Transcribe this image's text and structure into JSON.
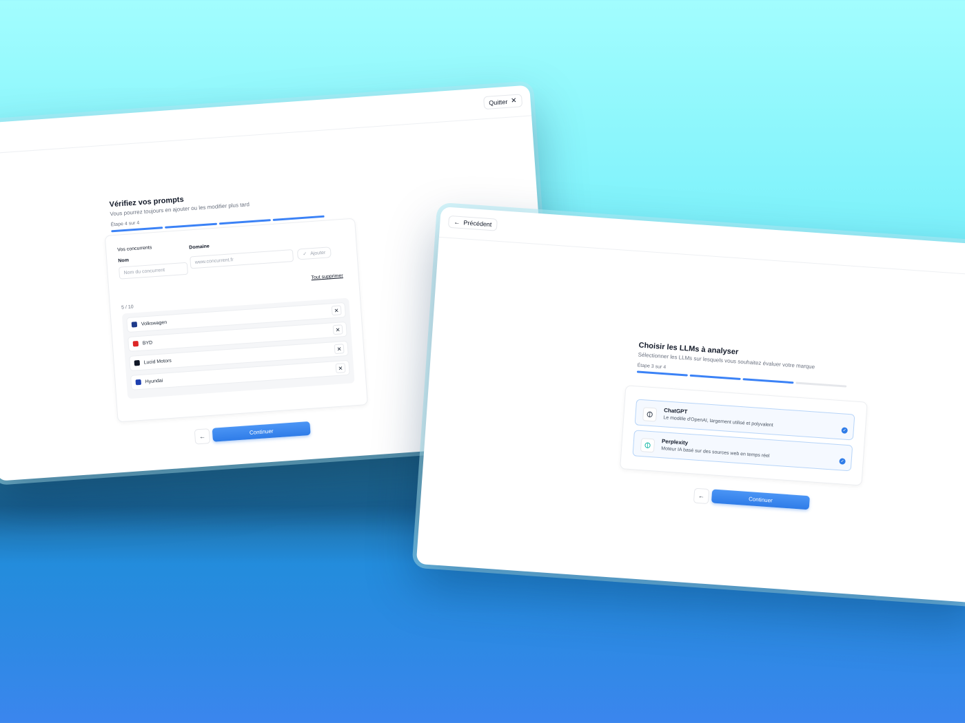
{
  "left_window": {
    "quit_label": "Quitter",
    "title": "Vérifiez vos prompts",
    "subtitle": "Vous pourrez toujours en ajouter ou les modifier plus tard",
    "step_label": "Étape 4 sur 4",
    "progress": {
      "current": 4,
      "total": 4
    },
    "section_label": "Vos concurrents",
    "name_label": "Nom",
    "domain_label": "Domaine",
    "name_placeholder": "Nom du concurrent",
    "domain_placeholder": "www.concurrent.fr",
    "add_label": "Ajouter",
    "clear_all_label": "Tout supprimer",
    "count_label": "5 / 10",
    "competitors": [
      {
        "name": "Volkswagen",
        "logo_color": "#1e3a8a"
      },
      {
        "name": "BYD",
        "logo_color": "#dc2626"
      },
      {
        "name": "Lucid Motors",
        "logo_color": "#111827"
      },
      {
        "name": "Hyundai",
        "logo_color": "#1e40af"
      }
    ],
    "continue_label": "Continuer"
  },
  "right_window": {
    "back_label": "Précédent",
    "title": "Choisir les LLMs à analyser",
    "subtitle": "Sélectionner les LLMs sur lesquels vous souhaitez évaluer votre marque",
    "step_label": "Étape 3 sur 4",
    "progress": {
      "current": 3,
      "total": 4
    },
    "llms": [
      {
        "name": "ChatGPT",
        "description": "Le modèle d'OpenAI, largement utilisé et polyvalent",
        "selected": true,
        "icon": "openai-icon"
      },
      {
        "name": "Perplexity",
        "description": "Moteur IA basé sur des sources web en temps réel",
        "selected": true,
        "icon": "perplexity-icon"
      }
    ],
    "continue_label": "Continuer"
  },
  "colors": {
    "accent": "#2f7ce8",
    "selected_border": "#b6d4f8"
  }
}
